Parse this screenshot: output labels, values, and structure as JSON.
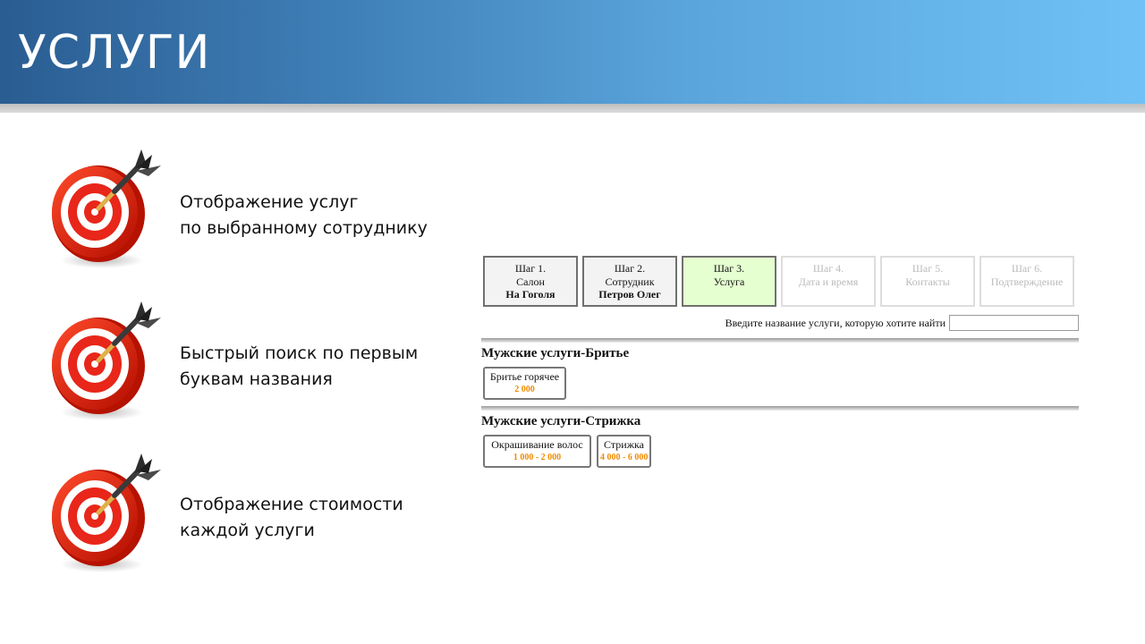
{
  "slide": {
    "title": "УСЛУГИ"
  },
  "features": [
    {
      "icon": "dartboard-target-icon",
      "lines": [
        "Отображение услуг",
        "по выбранному сотруднику"
      ]
    },
    {
      "icon": "dartboard-target-icon",
      "lines": [
        "Быстрый поиск по первым",
        "буквам названия"
      ]
    },
    {
      "icon": "dartboard-target-icon",
      "lines": [
        "Отображение стоимости",
        "каждой услуги"
      ]
    }
  ],
  "wizard": {
    "steps": [
      {
        "label": "Шаг 1.",
        "name": "Салон",
        "selection": "На Гоголя",
        "state": "done"
      },
      {
        "label": "Шаг 2.",
        "name": "Сотрудник",
        "selection": "Петров Олег",
        "state": "done"
      },
      {
        "label": "Шаг 3.",
        "name": "Услуга",
        "selection": "",
        "state": "active"
      },
      {
        "label": "Шаг 4.",
        "name": "Дата и время",
        "selection": "",
        "state": "disabled"
      },
      {
        "label": "Шаг 5.",
        "name": "Контакты",
        "selection": "",
        "state": "disabled"
      },
      {
        "label": "Шаг 6.",
        "name": "Подтверждение",
        "selection": "",
        "state": "disabled"
      }
    ],
    "search": {
      "label": "Введите название услуги, которую хотите найти",
      "value": "",
      "placeholder": ""
    },
    "categories": [
      {
        "title": "Мужские услуги-Бритье",
        "services": [
          {
            "name": "Бритье горячее",
            "price": "2 000"
          }
        ]
      },
      {
        "title": "Мужские услуги-Стрижка",
        "services": [
          {
            "name": "Окрашивание волос",
            "price": "1 000 - 2 000"
          },
          {
            "name": "Стрижка",
            "price": "4 000 - 6 000"
          }
        ]
      }
    ],
    "colors": {
      "active_step_bg": "#e5ffd0",
      "price": "#f08c00",
      "banner_start": "#2a5d92",
      "banner_end": "#6fc1f6"
    }
  }
}
